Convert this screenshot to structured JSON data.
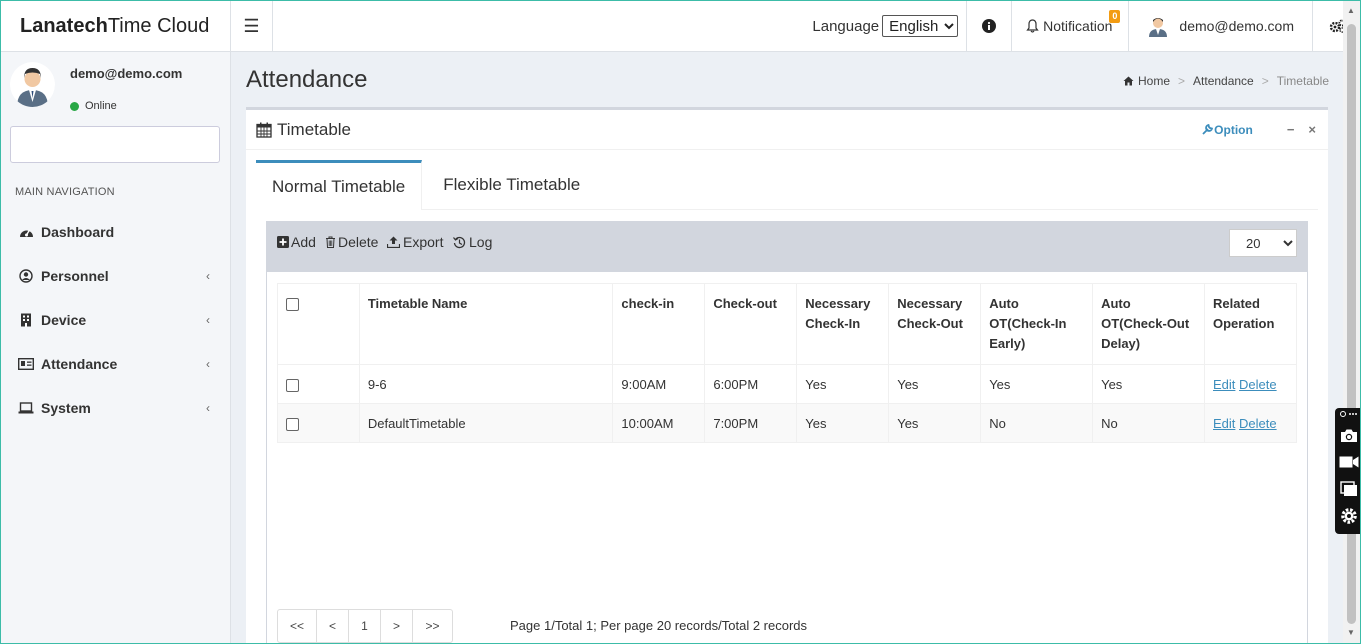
{
  "app": {
    "brand_bold": "Lanatech",
    "brand_rest": "Time Cloud"
  },
  "header": {
    "language_label": "Language",
    "language_selected": "English",
    "notification_label": "Notification",
    "notification_count": "0",
    "user_email": "demo@demo.com"
  },
  "sidebar": {
    "user_name": "demo@demo.com",
    "status": "Online",
    "nav_header": "MAIN NAVIGATION",
    "items": [
      {
        "label": "Dashboard",
        "icon": "dashboard-icon"
      },
      {
        "label": "Personnel",
        "icon": "user-circle-icon"
      },
      {
        "label": "Device",
        "icon": "building-icon"
      },
      {
        "label": "Attendance",
        "icon": "id-card-icon"
      },
      {
        "label": "System",
        "icon": "laptop-icon"
      }
    ]
  },
  "page": {
    "title": "Attendance",
    "breadcrumb": [
      "Home",
      "Attendance",
      "Timetable"
    ]
  },
  "box": {
    "title": "Timetable",
    "option_label": "Option",
    "minimize": "−",
    "close": "×"
  },
  "tabs": [
    "Normal Timetable",
    "Flexible Timetable"
  ],
  "toolbar": {
    "add": "Add",
    "delete": "Delete",
    "export": "Export",
    "log": "Log",
    "page_size": "20"
  },
  "table": {
    "headers": [
      "Timetable Name",
      "check-in",
      "Check-out",
      "Necessary Check-In",
      "Necessary Check-Out",
      "Auto OT(Check-In Early)",
      "Auto OT(Check-Out Delay)",
      "Related Operation"
    ],
    "rows": [
      {
        "name": "9-6",
        "checkin": "9:00AM",
        "checkout": "6:00PM",
        "nec_in": "Yes",
        "nec_out": "Yes",
        "ot_early": "Yes",
        "ot_delay": "Yes",
        "edit": "Edit",
        "delete": "Delete"
      },
      {
        "name": "DefaultTimetable",
        "checkin": "10:00AM",
        "checkout": "7:00PM",
        "nec_in": "Yes",
        "nec_out": "Yes",
        "ot_early": "No",
        "ot_delay": "No",
        "edit": "Edit",
        "delete": "Delete"
      }
    ]
  },
  "pager": {
    "first": "<<",
    "prev": "<",
    "current": "1",
    "next": ">",
    "last": ">>",
    "info": "Page 1/Total 1; Per page 20 records/Total 2 records"
  }
}
